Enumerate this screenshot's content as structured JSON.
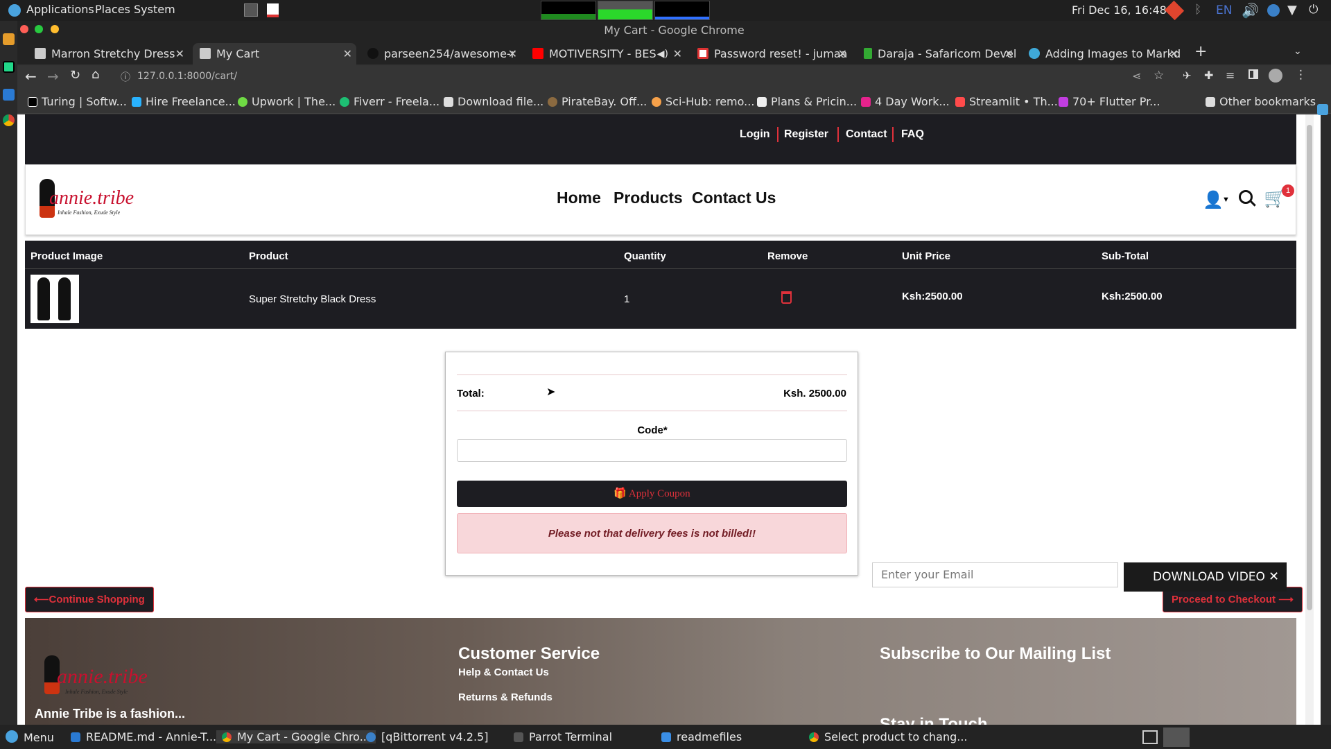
{
  "top_panel": {
    "menus": [
      "Applications",
      "Places",
      "System"
    ],
    "clock": "Fri Dec 16, 16:48",
    "lang": "EN"
  },
  "window": {
    "title": "My Cart - Google Chrome"
  },
  "tabs": [
    {
      "label": "Marron Stretchy Dress",
      "active": false
    },
    {
      "label": "My Cart",
      "active": true
    },
    {
      "label": "parseen254/awesome-r",
      "active": false
    },
    {
      "label": "MOTIVERSITY - BES",
      "active": false
    },
    {
      "label": "Password reset! - jumaa",
      "active": false
    },
    {
      "label": "Daraja - Safaricom Devel",
      "active": false
    },
    {
      "label": "Adding Images to Markd",
      "active": false
    }
  ],
  "address_bar": {
    "url": "127.0.0.1:8000/cart/"
  },
  "bookmarks": [
    "Turing | Softw...",
    "Hire Freelance...",
    "Upwork | The...",
    "Fiverr - Freela...",
    "Download file...",
    "PirateBay. Off...",
    "Sci-Hub: remo...",
    "Plans & Pricin...",
    "4 Day Work...",
    "Streamlit • Th...",
    "70+ Flutter Pr..."
  ],
  "other_bookmarks": "Other bookmarks",
  "site": {
    "top_links": [
      "Login",
      "Register",
      "Contact",
      "FAQ"
    ],
    "logo_text": "annie.tribe",
    "logo_tagline": "Inhale Fashion, Exude Style",
    "nav": [
      "Home",
      "Products",
      "Contact Us"
    ],
    "cart_count": "1",
    "accent_color": "#e0313b",
    "dark_color": "#1d1d22"
  },
  "cart_table": {
    "headers": [
      "Product Image",
      "Product",
      "Quantity",
      "Remove",
      "Unit Price",
      "Sub-Total"
    ],
    "rows": [
      {
        "product": "Super Stretchy Black Dress",
        "quantity": "1",
        "unit_price": "Ksh:2500.00",
        "subtotal": "Ksh:2500.00"
      }
    ]
  },
  "summary": {
    "total_label": "Total:",
    "total_value": "Ksh. 2500.00",
    "code_label": "Code*",
    "code_value": "",
    "apply_label": "Apply Coupon",
    "notice": "Please not that delivery fees is not billed!!"
  },
  "buttons": {
    "continue": "Continue Shopping",
    "checkout": "Proceed to Checkout"
  },
  "footer": {
    "customer_service_title": "Customer Service",
    "cs_links": [
      "Help & Contact Us",
      "Returns & Refunds"
    ],
    "mailing_title": "Subscribe to Our Mailing List",
    "email_placeholder": "Enter your Email",
    "stay_title": "Stay in Touch",
    "about_partial": "Annie Tribe is a fashion..."
  },
  "download_video": "DOWNLOAD VIDEO",
  "taskbar": {
    "menu": "Menu",
    "items": [
      {
        "label": "README.md - Annie-T...",
        "active": false
      },
      {
        "label": "My Cart - Google Chro...",
        "active": true
      },
      {
        "label": "[qBittorrent v4.2.5]",
        "active": false
      },
      {
        "label": "Parrot Terminal",
        "active": false
      },
      {
        "label": "readmefiles",
        "active": false
      },
      {
        "label": "Select product to chang...",
        "active": false
      }
    ]
  }
}
